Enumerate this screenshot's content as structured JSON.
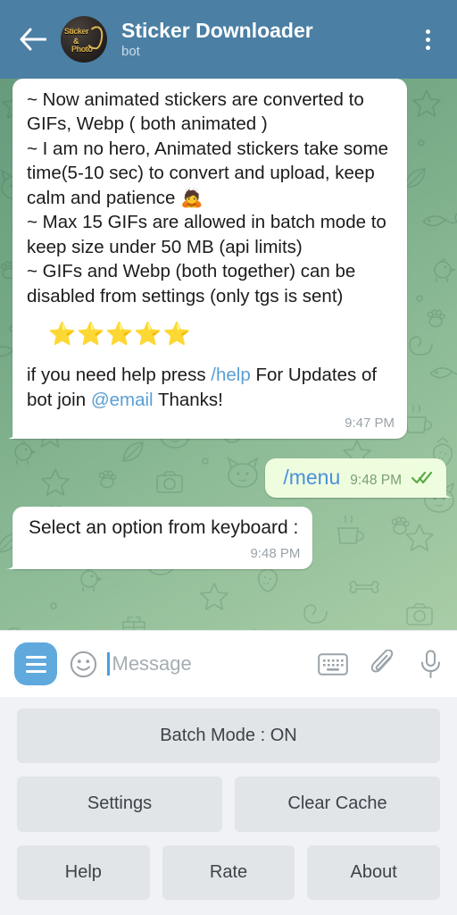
{
  "header": {
    "back_icon": "back-arrow-icon",
    "avatar": {
      "line1": "Sticker",
      "amp": "&",
      "line2": "Photo"
    },
    "title": "Sticker Downloader",
    "subtitle": "bot",
    "menu_icon": "overflow-menu-icon"
  },
  "messages": [
    {
      "direction": "incoming",
      "body": "~ Now animated stickers are converted to GIFs, Webp ( both animated )\n~ I am no hero, Animated stickers take some time(5-10 sec) to convert and upload, keep calm and patience 🙇\n~ Max 15 GIFs are allowed in batch mode to keep size under 50 MB (api limits)\n~ GIFs and Webp (both together) can be disabled from settings (only tgs is sent)",
      "stars": "⭐⭐⭐⭐⭐",
      "help_prefix": "if you need help press ",
      "help_link": "/help",
      "help_middle": " For Updates of bot join ",
      "help_link2": "@email",
      "help_suffix": " Thanks!",
      "time": "9:47 PM"
    },
    {
      "direction": "outgoing",
      "command": "/menu",
      "time": "9:48 PM",
      "ticks": "✓✓"
    },
    {
      "direction": "incoming",
      "text": "Select an option from keyboard :",
      "time": "9:48 PM"
    }
  ],
  "input_bar": {
    "menu_button": "bot-commands-menu",
    "emoji_icon": "smiley-face-icon",
    "placeholder": "Message",
    "keyboard_icon": "keyboard-icon",
    "attach_icon": "paperclip-icon",
    "mic_icon": "microphone-icon"
  },
  "keyboard": {
    "rows": [
      [
        "Batch Mode : ON"
      ],
      [
        "Settings",
        "Clear Cache"
      ],
      [
        "Help",
        "Rate",
        "About"
      ]
    ]
  },
  "colors": {
    "header": "#4b7fa4",
    "accent_blue": "#5fa9dd",
    "link_blue": "#5a9fd4",
    "outgoing_bubble": "#effddf",
    "incoming_bubble": "#ffffff",
    "keyboard_bg": "#f0f2f5",
    "keyboard_btn": "#e2e5e8"
  }
}
